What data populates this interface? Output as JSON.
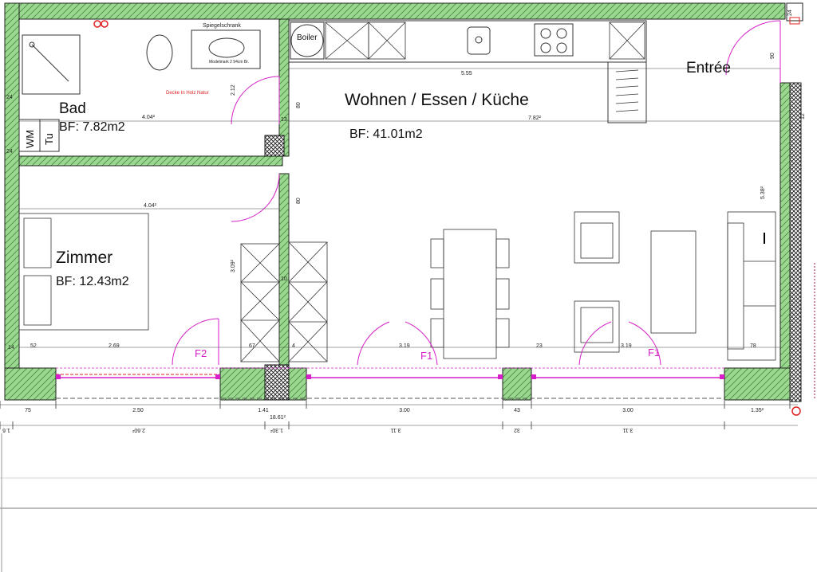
{
  "rooms": {
    "bad": {
      "name": "Bad",
      "area": "BF: 7.82m2"
    },
    "wohnen": {
      "name": "Wohnen / Essen / Küche",
      "area": "BF: 41.01m2"
    },
    "zimmer": {
      "name": "Zimmer",
      "area": "BF: 12.43m2"
    },
    "entree": {
      "name": "Entrée"
    }
  },
  "fixtures": {
    "boiler": "Boiler",
    "spiegelschrank": "Spiegelschrank",
    "modelmark": "Modelmark 2 94cm Br.",
    "decke": "Decke In Holz Natur",
    "wm": "WM",
    "tu": "Tu"
  },
  "doors": {
    "f1": "F1",
    "f2": "F2"
  },
  "inner_dims": {
    "bad_width": "4.04²",
    "zimmer_width": "4.04²",
    "kitchen_len": "5.55",
    "wohnen_width": "7.82²",
    "wohnen_depth": "5.38²",
    "zimmer_depth": "3.09²",
    "bad_depth": "2.12",
    "entree_90": "90",
    "dim_80a": "80",
    "dim_80b": "80",
    "dim_13": "13",
    "dim_12": "12",
    "dim_24a": "24",
    "dim_24b": "24",
    "dim_24c": "24",
    "dim_14": "14",
    "dim_10": "10",
    "dim_52": "52",
    "dim_269": "2.69",
    "dim_67": "67",
    "dim_319a": "3.19",
    "dim_23": "23",
    "dim_319b": "3.19",
    "dim_78": "78",
    "dim_4": "4"
  },
  "dim_line_1": [
    "75",
    "2.50",
    "1.41",
    "3.00",
    "43",
    "3.00",
    "1.35²"
  ],
  "dim_line_1_total": "18.61²",
  "dim_line_2": [
    "1.6",
    "2.60²",
    "1.30²",
    "3.11",
    "32",
    "3.11"
  ],
  "accent_colors": {
    "insulation": "#8fd18a",
    "door_magenta": "#d61fc8",
    "marker_red": "#e02020",
    "wall_hatch": "#333333"
  }
}
